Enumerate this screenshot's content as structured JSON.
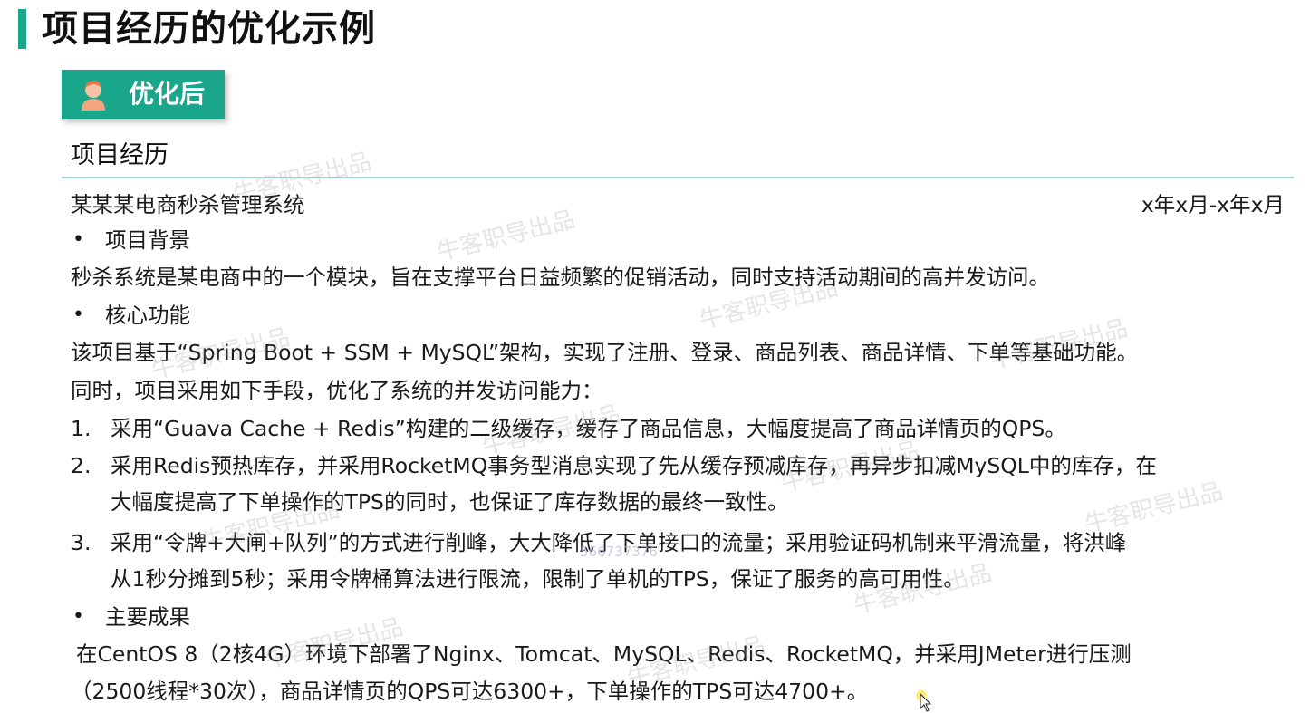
{
  "page": {
    "title": "项目经历的优化示例",
    "badge_label": "优化后"
  },
  "resume": {
    "section_heading": "项目经历",
    "project_name": "某某某电商秒杀管理系统",
    "date_range": "x年x月-x年x月",
    "background": {
      "bullet": "•",
      "heading": "项目背景",
      "text": "秒杀系统是某电商中的一个模块，旨在支撑平台日益频繁的促销活动，同时支持活动期间的高并发访问。"
    },
    "core": {
      "bullet": "•",
      "heading": "核心功能",
      "line1": "该项目基于“Spring Boot + SSM + MySQL”架构，实现了注册、登录、商品列表、商品详情、下单等基础功能。",
      "line2": "同时，项目采用如下手段，优化了系统的并发访问能力：",
      "items": [
        {
          "num": "1.",
          "lines": [
            "采用“Guava Cache + Redis”构建的二级缓存，缓存了商品信息，大幅度提高了商品详情页的QPS。"
          ]
        },
        {
          "num": "2.",
          "lines": [
            "采用Redis预热库存，并采用RocketMQ事务型消息实现了先从缓存预减库存，再异步扣减MySQL中的库存，在",
            "大幅度提高了下单操作的TPS的同时，也保证了库存数据的最终一致性。"
          ]
        },
        {
          "num": "3.",
          "lines": [
            "采用“令牌+大闸+队列”的方式进行削峰，大大降低了下单接口的流量；采用验证码机制来平滑流量，将洪峰",
            "从1秒分摊到5秒；采用令牌桶算法进行限流，限制了单机的TPS，保证了服务的高可用性。"
          ]
        }
      ]
    },
    "results": {
      "bullet": "•",
      "heading": "主要成果",
      "line1": "在CentOS 8（2核4G）环境下部署了Nginx、Tomcat、MySQL、Redis、RocketMQ，并采用JMeter进行压测",
      "line2": "（2500线程*30次），商品详情页的QPS可达6300+，下单操作的TPS可达4700+。"
    }
  },
  "watermark": {
    "text": "牛客职导出品",
    "overlay_id": "566737376"
  },
  "colors": {
    "accent": "#1aa68a",
    "divider": "#9fd6cb",
    "text": "#1a1a1a"
  },
  "icons": {
    "badge": "person-icon",
    "cursor": "mouse-pointer-icon"
  }
}
